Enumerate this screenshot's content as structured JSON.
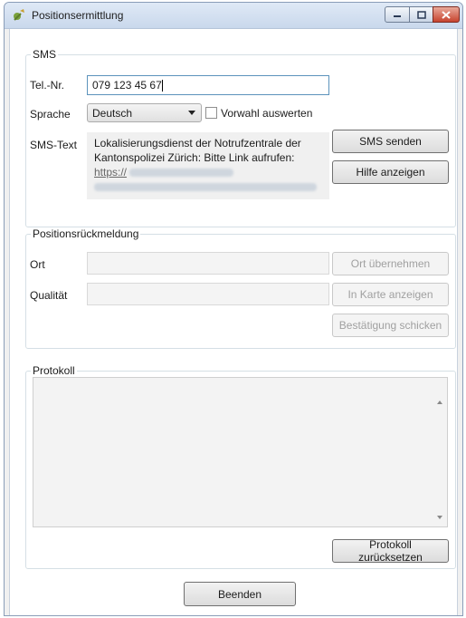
{
  "window": {
    "title": "Positionsermittlung"
  },
  "sms": {
    "group_label": "SMS",
    "phone_label": "Tel.-Nr.",
    "phone_value": "079 123 45 67",
    "language_label": "Sprache",
    "language_value": "Deutsch",
    "prefix_checkbox_label": "Vorwahl auswerten",
    "prefix_checked": false,
    "text_label": "SMS-Text",
    "text_line1": "Lokalisierungsdienst der Notrufzentrale der",
    "text_line2": "Kantonspolizei Zürich: Bitte Link aufrufen:",
    "text_link_prefix": "https://",
    "send_button": "SMS senden",
    "help_button": "Hilfe anzeigen"
  },
  "position": {
    "group_label": "Positionsrückmeldung",
    "location_label": "Ort",
    "quality_label": "Qualität",
    "apply_location_button": "Ort übernehmen",
    "show_map_button": "In Karte anzeigen",
    "send_confirmation_button": "Bestätigung schicken"
  },
  "log": {
    "group_label": "Protokoll",
    "reset_button": "Protokoll zurücksetzen"
  },
  "footer": {
    "exit_button": "Beenden"
  }
}
